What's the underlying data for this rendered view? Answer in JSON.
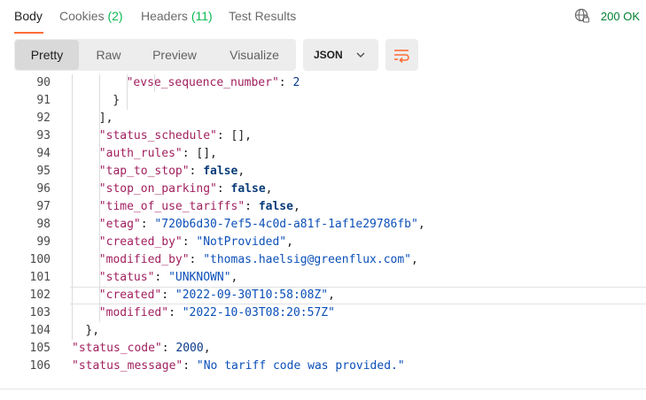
{
  "tabs": [
    {
      "label": "Body",
      "count": "",
      "active": true
    },
    {
      "label": "Cookies",
      "count": "(2)",
      "active": false
    },
    {
      "label": "Headers",
      "count": "(11)",
      "active": false
    },
    {
      "label": "Test Results",
      "count": "",
      "active": false
    }
  ],
  "status": {
    "text": "200 OK",
    "icon": "globe-icon",
    "color": "#007f31"
  },
  "view_modes": [
    {
      "label": "Pretty",
      "active": true
    },
    {
      "label": "Raw",
      "active": false
    },
    {
      "label": "Preview",
      "active": false
    },
    {
      "label": "Visualize",
      "active": false
    }
  ],
  "format": {
    "label": "JSON",
    "icon": "chevron-down-icon"
  },
  "wrap_button": {
    "icon": "wrap-lines-icon",
    "color": "#ff6c37"
  },
  "accent_color": "#ff6c37",
  "code_lines": [
    {
      "num": "90",
      "indent": 6,
      "tokens": [
        {
          "t": "key",
          "v": "\"evse_sequence_number\""
        },
        {
          "t": "p",
          "v": ": "
        },
        {
          "t": "num",
          "v": "2"
        }
      ]
    },
    {
      "num": "91",
      "indent": 5,
      "tokens": [
        {
          "t": "p",
          "v": "}"
        }
      ]
    },
    {
      "num": "92",
      "indent": 4,
      "tokens": [
        {
          "t": "p",
          "v": "],"
        }
      ]
    },
    {
      "num": "93",
      "indent": 4,
      "tokens": [
        {
          "t": "key",
          "v": "\"status_schedule\""
        },
        {
          "t": "p",
          "v": ": [],"
        }
      ]
    },
    {
      "num": "94",
      "indent": 4,
      "tokens": [
        {
          "t": "key",
          "v": "\"auth_rules\""
        },
        {
          "t": "p",
          "v": ": [],"
        }
      ]
    },
    {
      "num": "95",
      "indent": 4,
      "tokens": [
        {
          "t": "key",
          "v": "\"tap_to_stop\""
        },
        {
          "t": "p",
          "v": ": "
        },
        {
          "t": "kw",
          "v": "false"
        },
        {
          "t": "p",
          "v": ","
        }
      ]
    },
    {
      "num": "96",
      "indent": 4,
      "tokens": [
        {
          "t": "key",
          "v": "\"stop_on_parking\""
        },
        {
          "t": "p",
          "v": ": "
        },
        {
          "t": "kw",
          "v": "false"
        },
        {
          "t": "p",
          "v": ","
        }
      ]
    },
    {
      "num": "97",
      "indent": 4,
      "tokens": [
        {
          "t": "key",
          "v": "\"time_of_use_tariffs\""
        },
        {
          "t": "p",
          "v": ": "
        },
        {
          "t": "kw",
          "v": "false"
        },
        {
          "t": "p",
          "v": ","
        }
      ]
    },
    {
      "num": "98",
      "indent": 4,
      "tokens": [
        {
          "t": "key",
          "v": "\"etag\""
        },
        {
          "t": "p",
          "v": ": "
        },
        {
          "t": "str",
          "v": "\"720b6d30-7ef5-4c0d-a81f-1af1e29786fb\""
        },
        {
          "t": "p",
          "v": ","
        }
      ]
    },
    {
      "num": "99",
      "indent": 4,
      "tokens": [
        {
          "t": "key",
          "v": "\"created_by\""
        },
        {
          "t": "p",
          "v": ": "
        },
        {
          "t": "str",
          "v": "\"NotProvided\""
        },
        {
          "t": "p",
          "v": ","
        }
      ]
    },
    {
      "num": "100",
      "indent": 4,
      "tokens": [
        {
          "t": "key",
          "v": "\"modified_by\""
        },
        {
          "t": "p",
          "v": ": "
        },
        {
          "t": "str",
          "v": "\"thomas.haelsig@greenflux.com\""
        },
        {
          "t": "p",
          "v": ","
        }
      ]
    },
    {
      "num": "101",
      "indent": 4,
      "tokens": [
        {
          "t": "key",
          "v": "\"status\""
        },
        {
          "t": "p",
          "v": ": "
        },
        {
          "t": "str",
          "v": "\"UNKNOWN\""
        },
        {
          "t": "p",
          "v": ","
        }
      ]
    },
    {
      "num": "102",
      "indent": 4,
      "active": true,
      "tokens": [
        {
          "t": "key",
          "v": "\"created\""
        },
        {
          "t": "p",
          "v": ": "
        },
        {
          "t": "str",
          "v": "\"2022-09-30T10:58:08Z\""
        },
        {
          "t": "p",
          "v": ","
        }
      ]
    },
    {
      "num": "103",
      "indent": 4,
      "tokens": [
        {
          "t": "key",
          "v": "\"modified\""
        },
        {
          "t": "p",
          "v": ": "
        },
        {
          "t": "str",
          "v": "\"2022-10-03T08:20:57Z\""
        }
      ]
    },
    {
      "num": "104",
      "indent": 3,
      "tokens": [
        {
          "t": "p",
          "v": "},"
        }
      ]
    },
    {
      "num": "105",
      "indent": 2,
      "tokens": [
        {
          "t": "key",
          "v": "\"status_code\""
        },
        {
          "t": "p",
          "v": ": "
        },
        {
          "t": "num",
          "v": "2000"
        },
        {
          "t": "p",
          "v": ","
        }
      ]
    },
    {
      "num": "106",
      "indent": 2,
      "tokens": [
        {
          "t": "key",
          "v": "\"status_message\""
        },
        {
          "t": "p",
          "v": ": "
        },
        {
          "t": "str",
          "v": "\"No tariff code was provided.\""
        }
      ]
    }
  ]
}
